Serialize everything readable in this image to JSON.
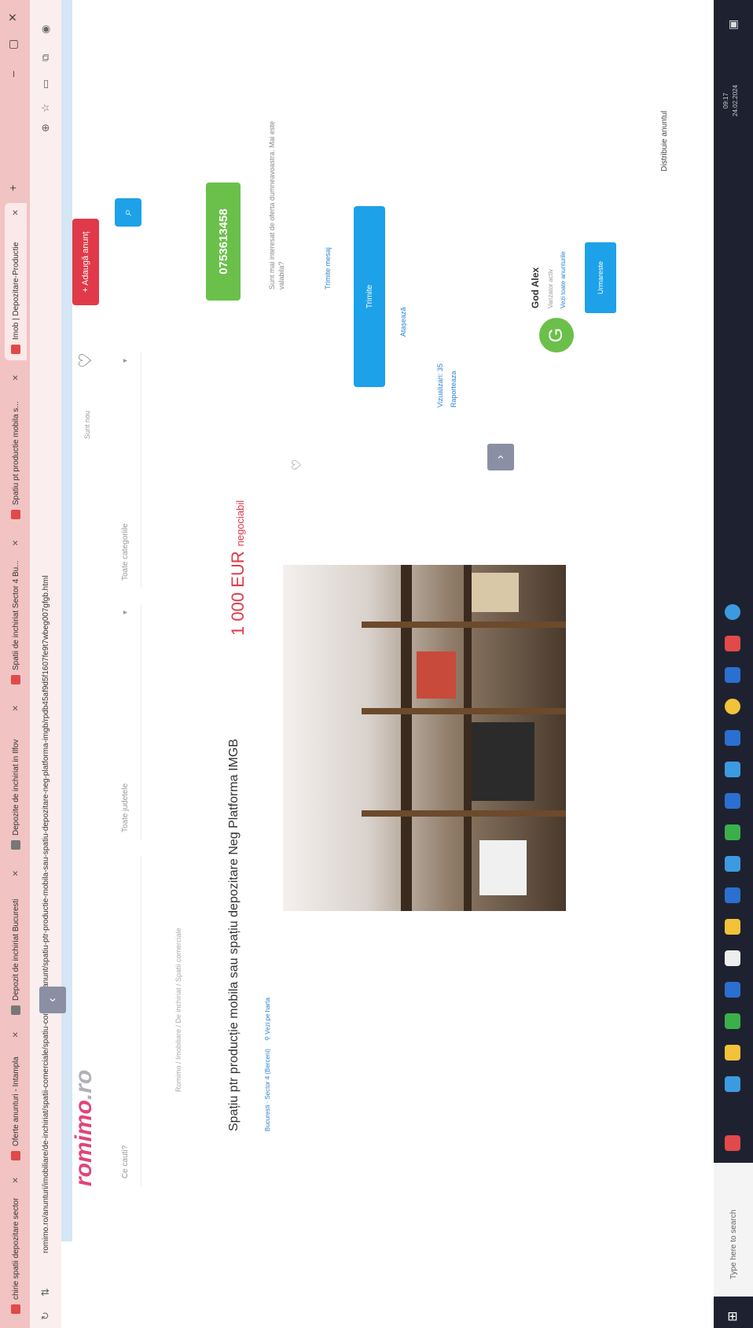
{
  "browser": {
    "tabs": [
      {
        "label": "chirie spatii depozitare sector",
        "active": false
      },
      {
        "label": "Oferte anunturi - Intampla",
        "active": false
      },
      {
        "label": "Depozit de inchiriat Bucuresti",
        "active": false
      },
      {
        "label": "Depozite de inchiriat in Ilfov",
        "active": false
      },
      {
        "label": "Spatii de inchiriat Sector 4 Bu...",
        "active": false
      },
      {
        "label": "Spatiu pt productie mobila s...",
        "active": false
      },
      {
        "label": "Imob | Depozitare-Productie",
        "active": true
      }
    ],
    "url": "romimo.ro/anunturi/imobiliare/de-inchiriat/spatii-comerciale/spatiu-comercial/anunt/spatiu-ptr-productie-mobila-sau-spatiu-depozitare-neg-platforma-imgb/rpdb45af9d5f1607fe9t7wbeg007gfgb.html"
  },
  "site": {
    "logo_main": "romimo",
    "logo_tld": ".ro",
    "favorites_label": "Sunt nou",
    "add_ad_label": "+ Adaugă anunț",
    "search": {
      "keyword_placeholder": "Ce cauti?",
      "location_placeholder": "Toate judetele",
      "category_placeholder": "Toate categoriile"
    },
    "breadcrumb": "Romimo / Imobiliare / De inchiriat / Spatii comerciale"
  },
  "listing": {
    "title": "Spațiu ptr producție mobila sau spațiu depozitare Neg Platforma IMGB",
    "location_link": "Bucuresti · Sector 4 (Berceni)",
    "map_link": "Vezi pe harta",
    "price": "1 000 EUR",
    "price_note": "negociabil"
  },
  "contact": {
    "phone": "0753613458",
    "question": "Sunt mai interesat de oferta dumneavoastra. Mai este valabila?",
    "message_link": "Trimite mesaj",
    "message_button": "Trimite",
    "attach_label": "Atașează",
    "views_label": "Vizualizari: 35",
    "report_label": "Raporteaza"
  },
  "seller": {
    "initial": "G",
    "name": "God Alex",
    "subtitle": "Vanzator activ",
    "all_ads_link": "Vezi toate anunturile",
    "follow_button": "Urmareste"
  },
  "footer": {
    "distribute_label": "Distribuie anuntul"
  },
  "taskbar": {
    "search_placeholder": "Type here to search",
    "time": "09:17",
    "date": "24.02.2024"
  },
  "colors": {
    "accent_red": "#e03a4a",
    "accent_blue": "#1da1e8",
    "phone_green": "#6ac04a",
    "logo_pink": "#e0457a"
  }
}
